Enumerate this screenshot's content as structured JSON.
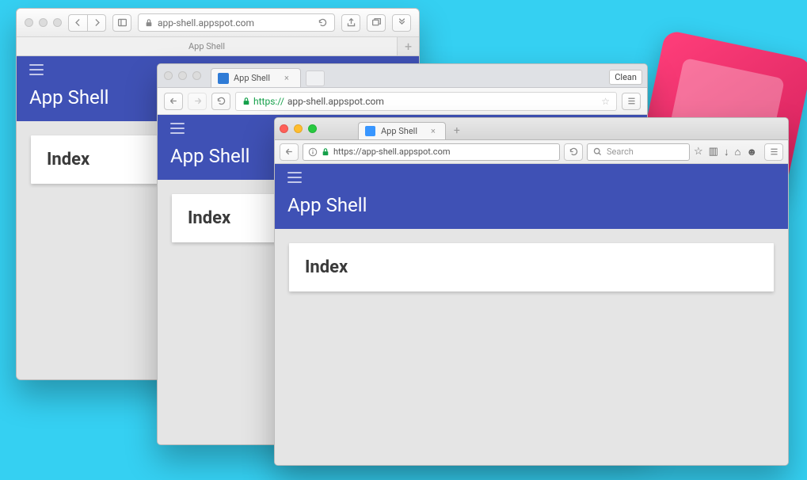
{
  "app": {
    "title": "App Shell",
    "card_heading": "Index"
  },
  "safari": {
    "tab_title": "App Shell",
    "url_display": "app-shell.appspot.com"
  },
  "chrome": {
    "tab_title": "App Shell",
    "clean_label": "Clean",
    "url_scheme": "https://",
    "url_rest": "app-shell.appspot.com",
    "tab_close": "×"
  },
  "firefox": {
    "tab_title": "App Shell",
    "tab_close": "×",
    "new_tab_label": "+",
    "url_display": "https://app-shell.appspot.com",
    "search_placeholder": "Search"
  }
}
